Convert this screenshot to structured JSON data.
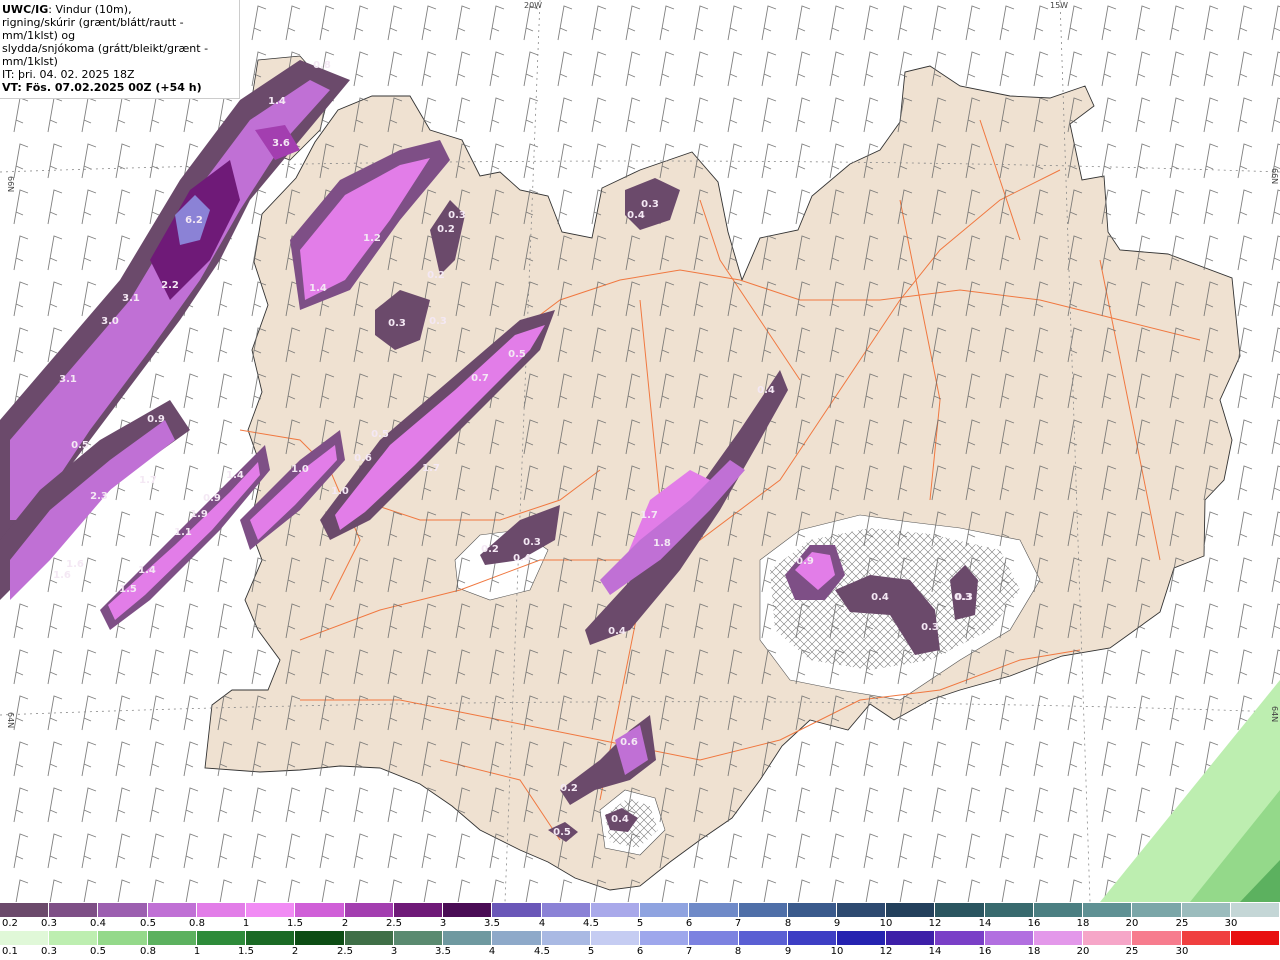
{
  "title": {
    "model": "UWC/IG",
    "line1_rest": ": Vindur (10m),",
    "line2": "rigning/skúrir (grænt/blátt/rautt - mm/1klst) og",
    "line3": "slydda/snjókoma (grátt/bleikt/grænt - mm/1klst)",
    "it_label": "IT: þri. 04. 02. 2025 18Z",
    "vt_label": "VT: Fös. 07.02.2025 00Z (+54 h)"
  },
  "grid_labels": {
    "lon_20w": "20W",
    "lon_15w": "15W",
    "lat_66n_left": "66N",
    "lat_66n_right": "66N",
    "lat_64n_left": "64N",
    "lat_64n_right": "64N"
  },
  "precip_labels": [
    "0.8",
    "1.4",
    "3.6",
    "6.2",
    "1.2",
    "1.4",
    "3.1",
    "2.2",
    "3.0",
    "3.1",
    "0.9",
    "0.5",
    "1.7",
    "2.3",
    "1.6",
    "1.6",
    "1.4",
    "1.5",
    "1.4",
    "0.9",
    "1.9",
    "1.1",
    "1.0",
    "1.0",
    "0.6",
    "0.5",
    "0.7",
    "0.5",
    "1.7",
    "0.3",
    "0.3",
    "0.3",
    "0.2",
    "0.2",
    "0.2",
    "0.3",
    "0.4",
    "0.3",
    "0.4",
    "0.4",
    "0.3",
    "1.7",
    "1.8",
    "0.4",
    "0.9",
    "0.4",
    "0.3",
    "0.3",
    "0.6",
    "0.2",
    "0.5",
    "0.4"
  ],
  "legend": {
    "snow": {
      "ticks": [
        "0.2",
        "0.3",
        "0.4",
        "0.5",
        "0.8",
        "1",
        "1.5",
        "2",
        "2.5",
        "3",
        "3.5",
        "4",
        "4.5",
        "5",
        "6",
        "7",
        "8",
        "9",
        "10",
        "12",
        "14",
        "16",
        "18",
        "20",
        "25",
        "30"
      ],
      "colors": [
        "#6b4a6b",
        "#7e4f86",
        "#9c5fb0",
        "#c070d5",
        "#e27de8",
        "#f18bf4",
        "#d05fd8",
        "#a33eb0",
        "#6f1a78",
        "#4a0c55",
        "#6a57b8",
        "#8b82d6",
        "#a9a9ea",
        "#8fa3e0",
        "#6f8ac8",
        "#4f6fa8",
        "#3a5a8c",
        "#2d4a70",
        "#23405c",
        "#2a5560",
        "#386a6e",
        "#4b7f82",
        "#5f9194",
        "#7ba6a8",
        "#9bbcbd",
        "#c4d6d6"
      ]
    },
    "rain": {
      "ticks": [
        "0.1",
        "0.3",
        "0.5",
        "0.8",
        "1",
        "1.5",
        "2",
        "2.5",
        "3",
        "3.5",
        "4",
        "4.5",
        "5",
        "6",
        "7",
        "8",
        "9",
        "10",
        "12",
        "14",
        "16",
        "18",
        "20",
        "25",
        "30"
      ],
      "colors": [
        "#e0f8d8",
        "#bdeeb0",
        "#94d98a",
        "#5cb15f",
        "#2e8b3a",
        "#1b6a25",
        "#0d4d14",
        "#3f6f47",
        "#5a8a70",
        "#6f99a0",
        "#8ea9c9",
        "#a9b9e3",
        "#c5ccf2",
        "#9ea7ec",
        "#7c82e0",
        "#5a5fd3",
        "#3d3ec4",
        "#2522b0",
        "#3d1fa8",
        "#7a3fc7",
        "#b26fe0",
        "#e398ea",
        "#f6a6c8",
        "#f77c8e",
        "#f04040",
        "#e81010"
      ]
    }
  },
  "colors": {
    "land": "#efe1d1",
    "sea": "#ffffff",
    "roads": "#f07840",
    "coast": "#333333",
    "wind": "#6a6a6a"
  }
}
